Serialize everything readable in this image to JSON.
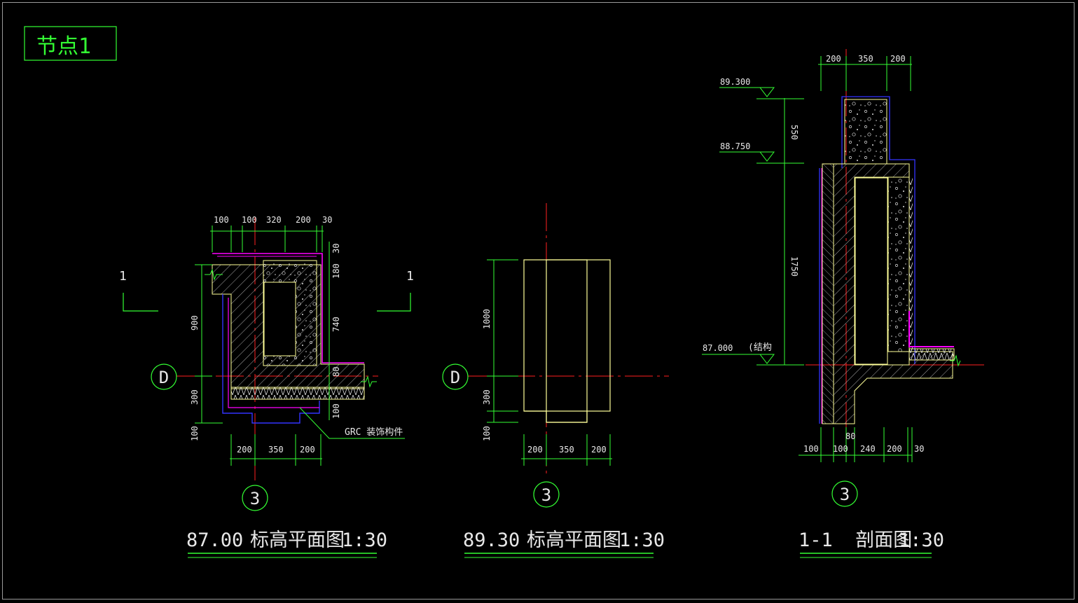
{
  "colors": {
    "background": "#000000",
    "dimension": "#33ff33",
    "axis": "#ff2020",
    "outline": "#ffff99",
    "finish": "#ff00ff",
    "edge": "#3333ff",
    "text": "#e8e8e8"
  },
  "node_tag": "节点1",
  "plan_a": {
    "dims_top": [
      "100",
      "100",
      "320",
      "200",
      "30"
    ],
    "dims_right": [
      "30",
      "180",
      "740",
      "80",
      "100"
    ],
    "dims_left": [
      "900",
      "300",
      "100"
    ],
    "dims_bottom": [
      "200",
      "350",
      "200"
    ],
    "grid_d": "D",
    "grid_3": "3",
    "section_mark_left": "1",
    "section_mark_right": "1",
    "note": "GRC 装饰构件",
    "title_elev": "87.00",
    "title_text": "标高平面图",
    "title_scale": "1:30"
  },
  "plan_b": {
    "dims_left": [
      "1000",
      "300",
      "100"
    ],
    "dims_bottom": [
      "200",
      "350",
      "200"
    ],
    "grid_d": "D",
    "grid_3": "3",
    "title_elev": "89.30",
    "title_text": "标高平面图",
    "title_scale": "1:30"
  },
  "section": {
    "dims_top": [
      "200",
      "350",
      "200"
    ],
    "dims_vertical": [
      "550",
      "1750"
    ],
    "levels": [
      "89.300",
      "88.750",
      "87.000"
    ],
    "level_note": "(结构",
    "dims_bottom": [
      "100",
      "100",
      "80",
      "240",
      "200",
      "30"
    ],
    "grid_3": "3",
    "title_text": "1-1  剖面图",
    "title_scale": "1:30"
  }
}
